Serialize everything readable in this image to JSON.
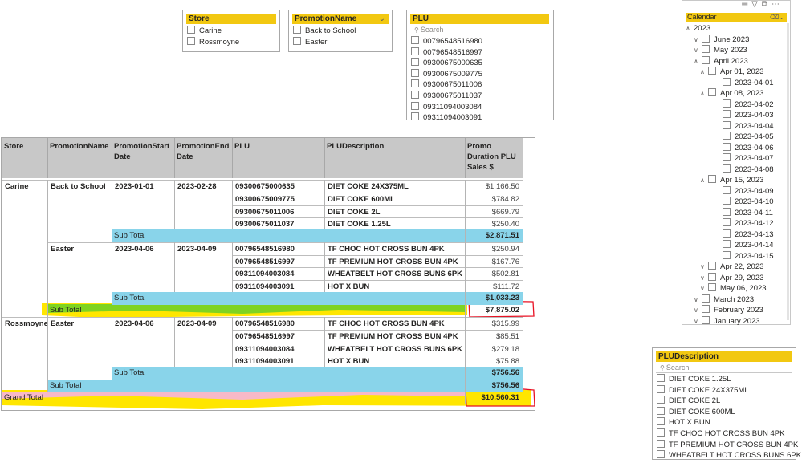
{
  "store_slicer": {
    "title": "Store",
    "items": [
      "Carine",
      "Rossmoyne"
    ]
  },
  "promo_slicer": {
    "title": "PromotionName",
    "items": [
      "Back to School",
      "Easter"
    ]
  },
  "plu_slicer": {
    "title": "PLU",
    "search_placeholder": "Search",
    "items": [
      "00796548516980",
      "00796548516997",
      "09300675000635",
      "09300675009775",
      "09300675011006",
      "09300675011037",
      "09311094003084",
      "09311094003091"
    ]
  },
  "plu_desc_slicer": {
    "title": "PLUDescription",
    "search_placeholder": "Search",
    "items": [
      "DIET COKE 1.25L",
      "DIET COKE 24X375ML",
      "DIET COKE 2L",
      "DIET COKE 600ML",
      "HOT X BUN",
      "TF CHOC HOT CROSS BUN 4PK",
      "TF PREMIUM HOT CROSS BUN 4PK",
      "WHEATBELT HOT CROSS BUNS 6PK"
    ]
  },
  "calendar": {
    "title": "Calendar",
    "toolbar_icons": [
      "drag-handle-icon",
      "filter-icon",
      "focus-mode-icon",
      "more-options-icon"
    ],
    "nodes": [
      {
        "label": "2023",
        "level": 0,
        "arrow": "up",
        "checkbox": false
      },
      {
        "label": "June 2023",
        "level": 1,
        "arrow": "down",
        "checkbox": true
      },
      {
        "label": "May 2023",
        "level": 1,
        "arrow": "down",
        "checkbox": true
      },
      {
        "label": "April 2023",
        "level": 1,
        "arrow": "up",
        "checkbox": true
      },
      {
        "label": "Apr 01, 2023",
        "level": 2,
        "arrow": "up",
        "checkbox": true
      },
      {
        "label": "2023-04-01",
        "level": 3,
        "arrow": "",
        "checkbox": true
      },
      {
        "label": "Apr 08, 2023",
        "level": 2,
        "arrow": "up",
        "checkbox": true
      },
      {
        "label": "2023-04-02",
        "level": 3,
        "arrow": "",
        "checkbox": true
      },
      {
        "label": "2023-04-03",
        "level": 3,
        "arrow": "",
        "checkbox": true
      },
      {
        "label": "2023-04-04",
        "level": 3,
        "arrow": "",
        "checkbox": true
      },
      {
        "label": "2023-04-05",
        "level": 3,
        "arrow": "",
        "checkbox": true
      },
      {
        "label": "2023-04-06",
        "level": 3,
        "arrow": "",
        "checkbox": true
      },
      {
        "label": "2023-04-07",
        "level": 3,
        "arrow": "",
        "checkbox": true
      },
      {
        "label": "2023-04-08",
        "level": 3,
        "arrow": "",
        "checkbox": true
      },
      {
        "label": "Apr 15, 2023",
        "level": 2,
        "arrow": "up",
        "checkbox": true
      },
      {
        "label": "2023-04-09",
        "level": 3,
        "arrow": "",
        "checkbox": true
      },
      {
        "label": "2023-04-10",
        "level": 3,
        "arrow": "",
        "checkbox": true
      },
      {
        "label": "2023-04-11",
        "level": 3,
        "arrow": "",
        "checkbox": true
      },
      {
        "label": "2023-04-12",
        "level": 3,
        "arrow": "",
        "checkbox": true
      },
      {
        "label": "2023-04-13",
        "level": 3,
        "arrow": "",
        "checkbox": true
      },
      {
        "label": "2023-04-14",
        "level": 3,
        "arrow": "",
        "checkbox": true
      },
      {
        "label": "2023-04-15",
        "level": 3,
        "arrow": "",
        "checkbox": true
      },
      {
        "label": "Apr 22, 2023",
        "level": 2,
        "arrow": "down",
        "checkbox": true
      },
      {
        "label": "Apr 29, 2023",
        "level": 2,
        "arrow": "down",
        "checkbox": true
      },
      {
        "label": "May 06, 2023",
        "level": 2,
        "arrow": "down",
        "checkbox": true
      },
      {
        "label": "March 2023",
        "level": 1,
        "arrow": "down",
        "checkbox": true
      },
      {
        "label": "February 2023",
        "level": 1,
        "arrow": "down",
        "checkbox": true
      },
      {
        "label": "January 2023",
        "level": 1,
        "arrow": "down",
        "checkbox": true
      }
    ]
  },
  "matrix": {
    "headers": [
      "Store",
      "PromotionName",
      "PromotionStart Date",
      "PromotionEnd Date",
      "PLU",
      "PLUDescription",
      "Promo Duration PLU Sales $"
    ],
    "rows": [
      {
        "store": "Carine",
        "promo": "Back to School",
        "start": "2023-01-01",
        "end": "2023-02-28",
        "plu": "09300675000635",
        "desc": "DIET COKE 24X375ML",
        "sales": "$1,166.50"
      },
      {
        "store": "",
        "promo": "",
        "start": "",
        "end": "",
        "plu": "09300675009775",
        "desc": "DIET COKE 600ML",
        "sales": "$784.82"
      },
      {
        "store": "",
        "promo": "",
        "start": "",
        "end": "",
        "plu": "09300675011006",
        "desc": "DIET COKE 2L",
        "sales": "$669.79"
      },
      {
        "store": "",
        "promo": "",
        "start": "",
        "end": "",
        "plu": "09300675011037",
        "desc": "DIET COKE 1.25L",
        "sales": "$250.40"
      },
      {
        "subtotal": "Sub Total",
        "level": "promo",
        "sales": "$2,871.51"
      },
      {
        "store": "",
        "promo": "Easter",
        "start": "2023-04-06",
        "end": "2023-04-09",
        "plu": "00796548516980",
        "desc": "TF CHOC HOT CROSS BUN 4PK",
        "sales": "$250.94"
      },
      {
        "store": "",
        "promo": "",
        "start": "",
        "end": "",
        "plu": "00796548516997",
        "desc": "TF PREMIUM HOT CROSS BUN 4PK",
        "sales": "$167.76"
      },
      {
        "store": "",
        "promo": "",
        "start": "",
        "end": "",
        "plu": "09311094003084",
        "desc": "WHEATBELT HOT CROSS BUNS 6PK",
        "sales": "$502.81"
      },
      {
        "store": "",
        "promo": "",
        "start": "",
        "end": "",
        "plu": "09311094003091",
        "desc": "HOT X BUN",
        "sales": "$111.72"
      },
      {
        "subtotal": "Sub Total",
        "level": "promo",
        "sales": "$1,033.23"
      },
      {
        "subtotal": "Sub Total",
        "level": "store-highlight",
        "sales": "$7,875.02"
      },
      {
        "store": "Rossmoyne",
        "promo": "Easter",
        "start": "2023-04-06",
        "end": "2023-04-09",
        "plu": "00796548516980",
        "desc": "TF CHOC HOT CROSS BUN 4PK",
        "sales": "$315.99"
      },
      {
        "store": "",
        "promo": "",
        "start": "",
        "end": "",
        "plu": "00796548516997",
        "desc": "TF PREMIUM HOT CROSS BUN 4PK",
        "sales": "$85.51"
      },
      {
        "store": "",
        "promo": "",
        "start": "",
        "end": "",
        "plu": "09311094003084",
        "desc": "WHEATBELT HOT CROSS BUNS 6PK",
        "sales": "$279.18"
      },
      {
        "store": "",
        "promo": "",
        "start": "",
        "end": "",
        "plu": "09311094003091",
        "desc": "HOT X BUN",
        "sales": "$75.88"
      },
      {
        "subtotal": "Sub Total",
        "level": "promo",
        "sales": "$756.56"
      },
      {
        "subtotal": "Sub Total",
        "level": "store",
        "sales": "$756.56"
      },
      {
        "subtotal": "Grand Total",
        "level": "grand",
        "sales": "$10,560.31"
      }
    ]
  },
  "colors": {
    "accent": "#f2c811",
    "subtotal_bg": "#89d4ea",
    "header_bg": "#c8c8c8",
    "annotation_red": "#e81123",
    "highlight_green": "#7fd321",
    "highlight_yellow": "#ffe600"
  }
}
